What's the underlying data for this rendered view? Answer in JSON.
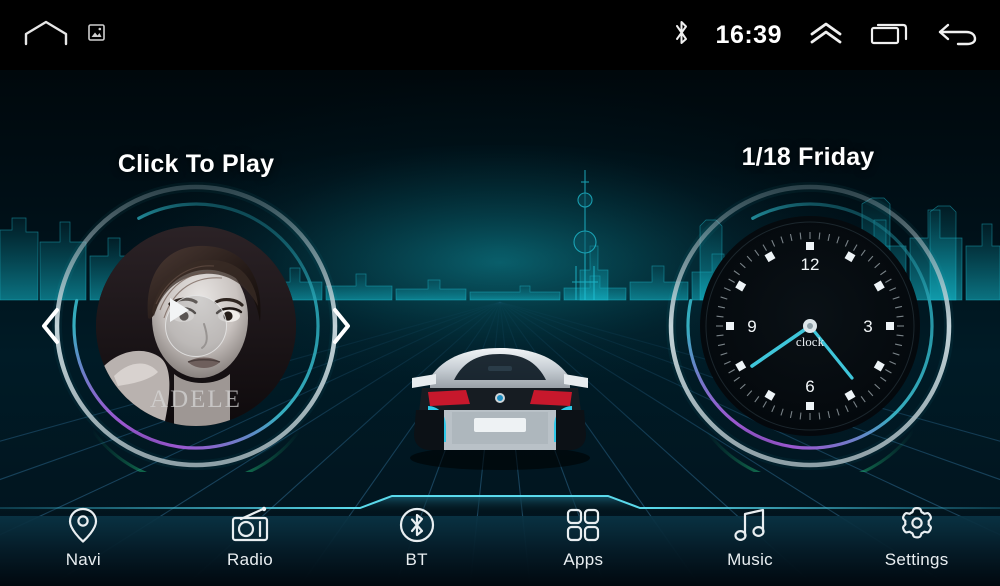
{
  "statusbar": {
    "home_icon": "home-icon",
    "screenshot_icon": "screenshot-icon",
    "bluetooth_icon": "bluetooth-icon",
    "time": "16:39",
    "expand_icon": "chevron-up-icon",
    "recents_icon": "recent-apps-icon",
    "back_icon": "back-arrow-icon"
  },
  "music_widget": {
    "title": "Click To Play",
    "album_artist": "ADELE",
    "prev_icon": "chevron-left-icon",
    "next_icon": "chevron-right-icon",
    "play_icon": "play-icon"
  },
  "clock_widget": {
    "date": "1/18  Friday",
    "face_label": "clock",
    "numerals": [
      "12",
      "3",
      "6",
      "9"
    ]
  },
  "dock": {
    "items": [
      {
        "label": "Navi",
        "icon": "map-pin-icon"
      },
      {
        "label": "Radio",
        "icon": "radio-icon"
      },
      {
        "label": "BT",
        "icon": "bluetooth-circle-icon"
      },
      {
        "label": "Apps",
        "icon": "grid-apps-icon"
      },
      {
        "label": "Music",
        "icon": "music-note-icon"
      },
      {
        "label": "Settings",
        "icon": "gear-icon"
      }
    ]
  },
  "background": {
    "skyline": "city-skyline-silhouette",
    "car": "sports-car-rear-view",
    "grid": "perspective-grid-floor"
  },
  "colors": {
    "accent_cyan": "#35c8d8",
    "accent_purple": "#a35ad8",
    "accent_green": "#1fc07a",
    "ring_silver": "#c8ced2",
    "bar_text": "#e9eef1",
    "bg_dark": "#001018"
  }
}
